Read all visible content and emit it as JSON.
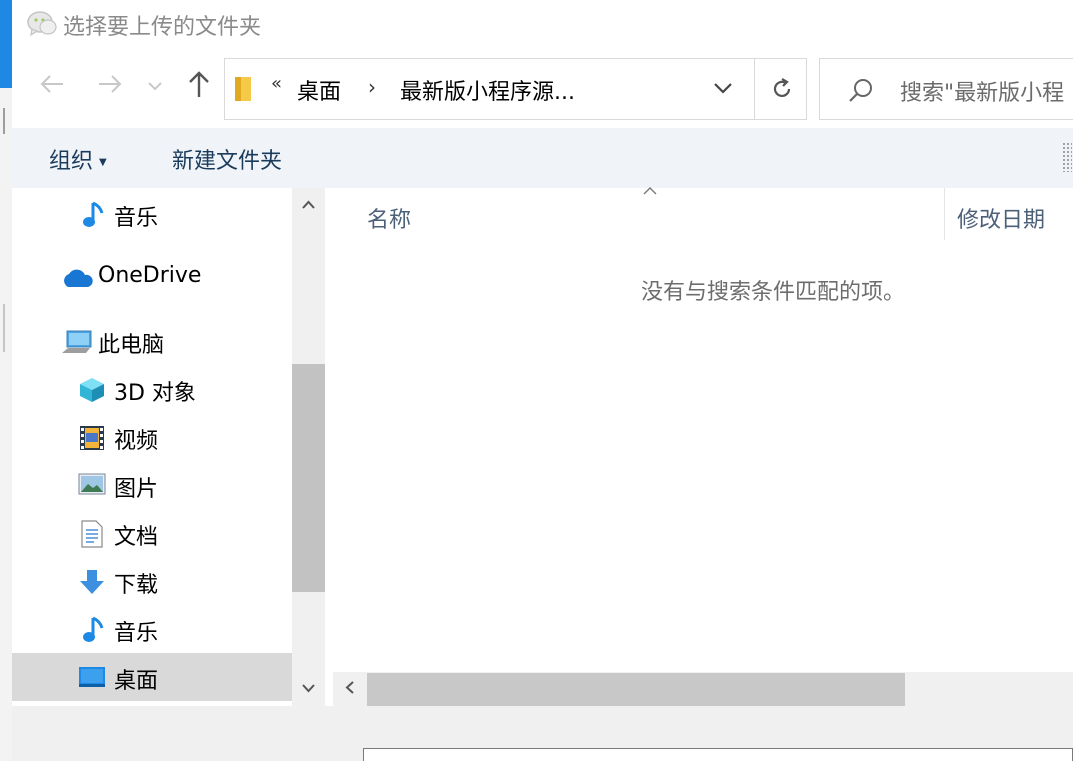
{
  "window": {
    "title": "选择要上传的文件夹"
  },
  "address": {
    "chevron": "«",
    "segment1": "桌面",
    "separator": "›",
    "segment2": "最新版小程序源..."
  },
  "search": {
    "placeholder": "搜索\"最新版小程序源...\"",
    "visible_text": "搜索\"最新版小程"
  },
  "toolbar": {
    "organize": "组织",
    "new_folder": "新建文件夹"
  },
  "nav": {
    "items": [
      {
        "label": "音乐",
        "icon": "music-icon"
      },
      {
        "label": "OneDrive",
        "icon": "onedrive-icon"
      },
      {
        "label": "此电脑",
        "icon": "computer-icon"
      },
      {
        "label": "3D 对象",
        "icon": "3d-objects-icon"
      },
      {
        "label": "视频",
        "icon": "video-icon"
      },
      {
        "label": "图片",
        "icon": "pictures-icon"
      },
      {
        "label": "文档",
        "icon": "documents-icon"
      },
      {
        "label": "下载",
        "icon": "downloads-icon"
      },
      {
        "label": "音乐",
        "icon": "music-icon"
      },
      {
        "label": "桌面",
        "icon": "desktop-icon",
        "selected": true
      }
    ]
  },
  "content": {
    "columns": [
      "名称",
      "修改日期"
    ],
    "empty_message": "没有与搜索条件匹配的项。"
  },
  "colors": {
    "accent_blue": "#1e88e5",
    "toolbar_bg": "#f0f4f9",
    "selected_bg": "#d9d9d9",
    "header_text": "#4c607a"
  }
}
